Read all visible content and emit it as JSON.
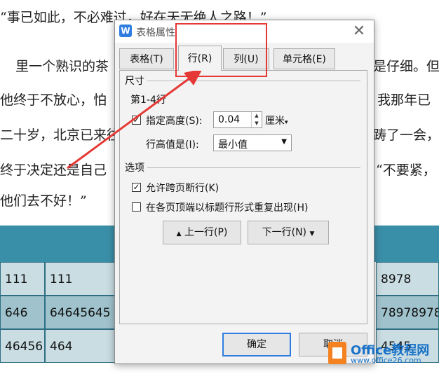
{
  "document": {
    "lines": [
      "“事已如此，不必难过，好在天无绝人之路！”",
      "里一个熟识的茶",
      "他终于不放心，怕",
      "二十岁，北京已来往",
      "终于决定还是自己",
      "他们去不好！”"
    ],
    "right_lines": [
      "是仔细。但",
      "我那年已",
      "踌了一会，",
      "“不要紧，"
    ]
  },
  "table": {
    "rows": [
      {
        "c1": "111",
        "c2": "111",
        "c3": "8978"
      },
      {
        "c1": "646",
        "c2": "64645645",
        "c3": "78978978"
      },
      {
        "c1": "46456",
        "c2": "464",
        "c3": "4545"
      }
    ]
  },
  "dialog": {
    "title": "表格属性",
    "app_icon": "W",
    "tabs": [
      "表格(T)",
      "行(R)",
      "列(U)",
      "单元格(E)"
    ],
    "active_tab": "行(R)",
    "size_group": "尺寸",
    "row_range": "第1-4行",
    "height_checkbox_label": "指定高度(S):",
    "height_checked": true,
    "height_value": "0.04",
    "height_unit": "厘米",
    "row_height_is_label": "行高值是(I):",
    "row_height_mode": "最小值",
    "options_group": "选项",
    "allow_break_label": "允许跨页断行(K)",
    "allow_break_checked": true,
    "repeat_header_label": "在各页顶端以标题行形式重复出现(H)",
    "repeat_header_checked": false,
    "prev_row_button": "上一行(P)",
    "next_row_button": "下一行(N)",
    "ok_button": "确定",
    "cancel_button": "取消"
  },
  "watermark": {
    "text": "Office教程网",
    "url": "www.office26.com"
  },
  "colors": {
    "accent": "#2f7de1",
    "annotation": "#e53935",
    "table_header": "#3a8fa8"
  }
}
